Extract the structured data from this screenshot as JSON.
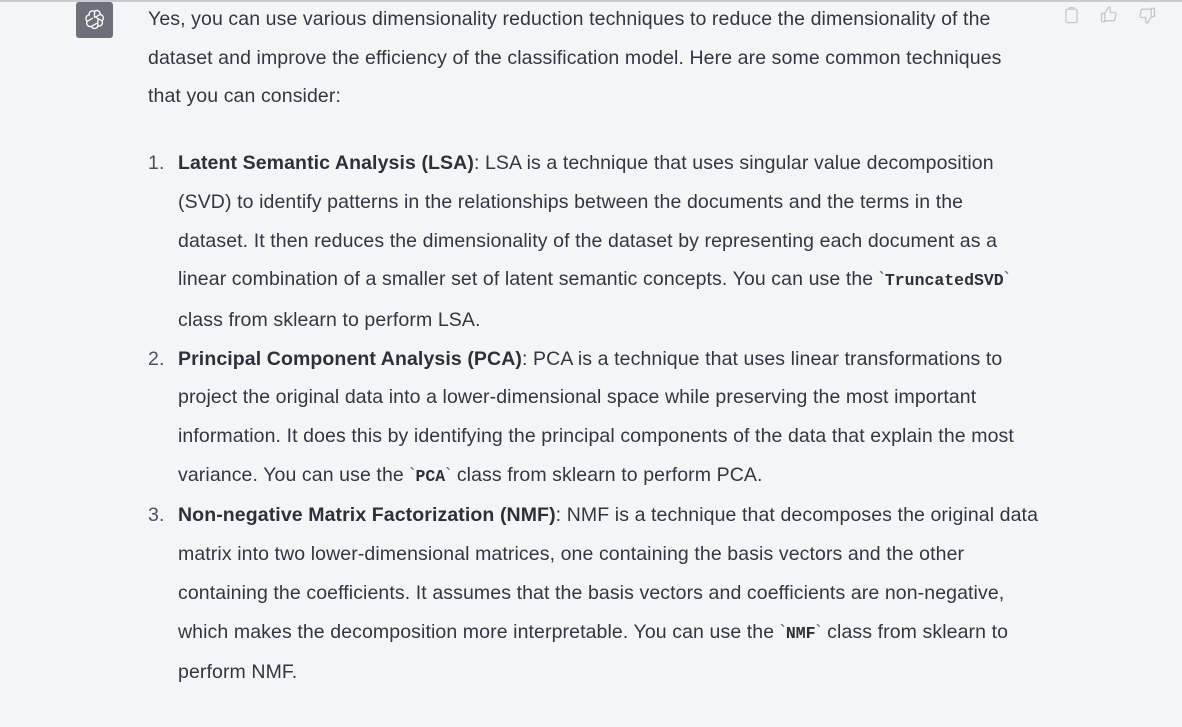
{
  "message": {
    "author_icon": "openai-logo-icon",
    "intro_paragraph": "Yes, you can use various dimensionality reduction techniques to reduce the dimensionality of the dataset and improve the efficiency of the classification model. Here are some common techniques that you can consider:",
    "list_items": [
      {
        "number": "1.",
        "term": "Latent Semantic Analysis (LSA)",
        "separator": ": ",
        "body_before_code": "LSA is a technique that uses singular value decomposition (SVD) to identify patterns in the relationships between the documents and the terms in the dataset. It then reduces the dimensionality of the dataset by representing each document as a linear combination of a smaller set of latent semantic concepts. You can use the ",
        "code": "TruncatedSVD",
        "body_after_code": " class from sklearn to perform LSA."
      },
      {
        "number": "2.",
        "term": "Principal Component Analysis (PCA)",
        "separator": ": ",
        "body_before_code": "PCA is a technique that uses linear transformations to project the original data into a lower-dimensional space while preserving the most important information. It does this by identifying the principal components of the data that explain the most variance. You can use the ",
        "code": "PCA",
        "body_after_code": " class from sklearn to perform PCA."
      },
      {
        "number": "3.",
        "term": "Non-negative Matrix Factorization (NMF)",
        "separator": ": ",
        "body_before_code": "NMF is a technique that decomposes the original data matrix into two lower-dimensional matrices, one containing the basis vectors and the other containing the coefficients. It assumes that the basis vectors and coefficients are non-negative, which makes the decomposition more interpretable. You can use the ",
        "code": "NMF",
        "body_after_code": " class from sklearn to perform NMF."
      }
    ],
    "code_tick": "`"
  },
  "actions": [
    {
      "name": "copy-icon",
      "label": "Copy"
    },
    {
      "name": "thumbs-up-icon",
      "label": "Good response"
    },
    {
      "name": "thumbs-down-icon",
      "label": "Bad response"
    }
  ],
  "colors": {
    "background": "#F4F5F7",
    "text": "#343541",
    "avatar_background": "#6E7079",
    "icon_stroke": "#C5C7CE",
    "top_rule": "#C9CBD1"
  }
}
